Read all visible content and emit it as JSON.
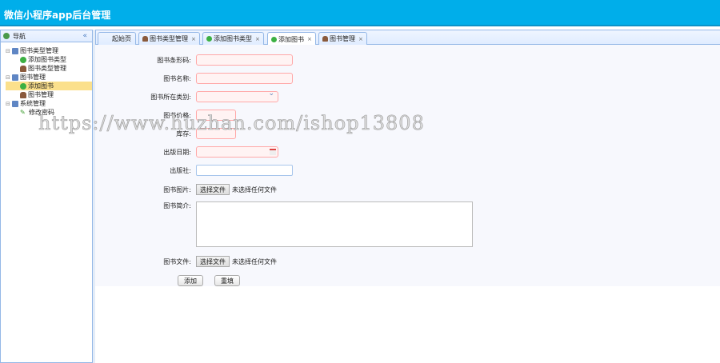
{
  "header": {
    "title": "微信小程序app后台管理"
  },
  "sidebar": {
    "title": "导航",
    "collapse": "«",
    "tree": [
      {
        "label": "图书类型管理",
        "level": 0,
        "icon": "computer-icon"
      },
      {
        "label": "添加图书类型",
        "level": 1,
        "icon": "add-icon"
      },
      {
        "label": "图书类型管理",
        "level": 1,
        "icon": "user-icon"
      },
      {
        "label": "图书管理",
        "level": 0,
        "icon": "computer-icon"
      },
      {
        "label": "添加图书",
        "level": 1,
        "icon": "add-icon",
        "selected": true
      },
      {
        "label": "图书管理",
        "level": 1,
        "icon": "user-icon"
      },
      {
        "label": "系统管理",
        "level": 0,
        "icon": "computer-icon"
      },
      {
        "label": "修改密码",
        "level": 1,
        "icon": "pencil-icon"
      }
    ]
  },
  "tabs": [
    {
      "label": "起始页"
    },
    {
      "label": "图书类型管理",
      "close": "×"
    },
    {
      "label": "添加图书类型",
      "close": "×"
    },
    {
      "label": "添加图书",
      "close": "×",
      "active": true
    },
    {
      "label": "图书管理",
      "close": "×"
    }
  ],
  "form": {
    "barcode": "图书条形码:",
    "name": "图书名称:",
    "category": "图书所在类别:",
    "price": "图书价格:",
    "stock": "库存:",
    "date": "出版日期:",
    "publisher": "出版社:",
    "image": "图书图片:",
    "intro": "图书简介:",
    "file": "图书文件:",
    "choose_file": "选择文件",
    "no_file": "未选择任何文件",
    "submit": "添加",
    "reset": "重填"
  },
  "watermark": "https://www.huzhan.com/ishop13808"
}
